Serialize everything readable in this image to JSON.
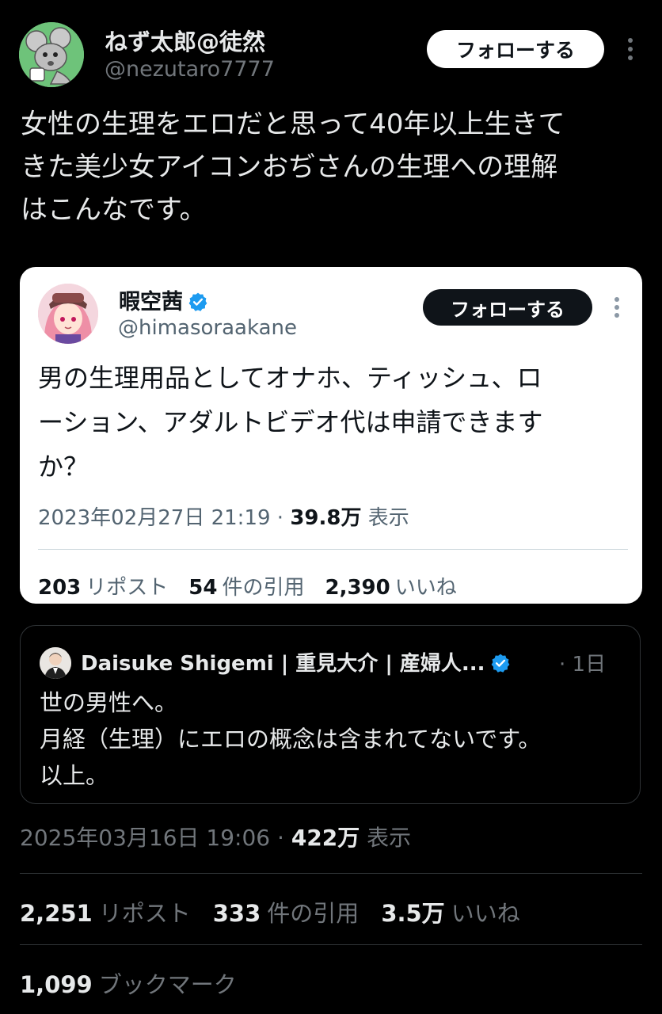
{
  "main_tweet": {
    "author_name": "ねず太郎@徒然",
    "author_handle": "@nezutaro7777",
    "follow_label": "フォローする",
    "text": "女性の生理をエロだと思って40年以上生きて\nきた美少女アイコンおぢさんの生理への理解\nはこんなです。",
    "date": "2025年03月16日 19:06",
    "views": "422万",
    "views_label": "表示",
    "reposts": "2,251",
    "reposts_label": "リポスト",
    "quotes": "333",
    "quotes_label": "件の引用",
    "likes": "3.5万",
    "likes_label": "いいね",
    "bookmarks": "1,099",
    "bookmarks_label": "ブックマーク"
  },
  "quoted_tweet": {
    "author_name": "暇空茜",
    "author_handle": "@himasoraakane",
    "follow_label": "フォローする",
    "text": "男の生理用品としてオナホ、ティッシュ、ロ\nーション、アダルトビデオ代は申請できます\nか？",
    "date": "2023年02月27日 21:19",
    "views": "39.8万",
    "views_label": "表示",
    "reposts": "203",
    "reposts_label": "リポスト",
    "quotes": "54",
    "quotes_label": "件の引用",
    "likes": "2,390",
    "likes_label": "いいね"
  },
  "embedded_tweet": {
    "author_name": "Daisuke Shigemi | 重見大介 | 産婦人...",
    "time": "1日",
    "text": "世の男性へ。\n月経（生理）にエロの概念は含まれてないです。\n以上。"
  },
  "colors": {
    "background": "#000000",
    "primary_text": "#e7e9ea",
    "secondary_text": "#71767b",
    "verified_blue": "#1d9bf0"
  }
}
